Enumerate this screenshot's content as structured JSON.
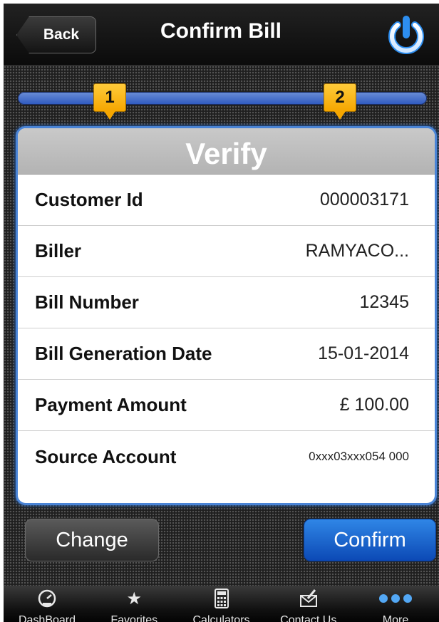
{
  "navbar": {
    "back_label": "Back",
    "title": "Confirm Bill"
  },
  "progress": {
    "steps": [
      "1",
      "2"
    ],
    "accent": "#2d58c0",
    "step_color": "#f5a600"
  },
  "card": {
    "title": "Verify",
    "rows": [
      {
        "label": "Customer Id",
        "value": "000003171"
      },
      {
        "label": "Biller",
        "value": "RAMYACO..."
      },
      {
        "label": "Bill Number",
        "value": "12345"
      },
      {
        "label": "Bill Generation Date",
        "value": "15-01-2014"
      },
      {
        "label": "Payment Amount",
        "value": "£ 100.00"
      },
      {
        "label": "Source Account",
        "value": "0xxx03xxx054  000"
      }
    ]
  },
  "actions": {
    "change_label": "Change",
    "confirm_label": "Confirm",
    "confirm_color": "#0c49b5"
  },
  "tabbar": {
    "tabs": [
      {
        "label": "DashBoard",
        "icon": "dashboard-gauge-icon"
      },
      {
        "label": "Favorites",
        "icon": "star-icon"
      },
      {
        "label": "Calculators",
        "icon": "calculator-icon"
      },
      {
        "label": "Contact Us",
        "icon": "envelope-icon"
      },
      {
        "label": "More",
        "icon": "more-dots-icon"
      }
    ]
  }
}
